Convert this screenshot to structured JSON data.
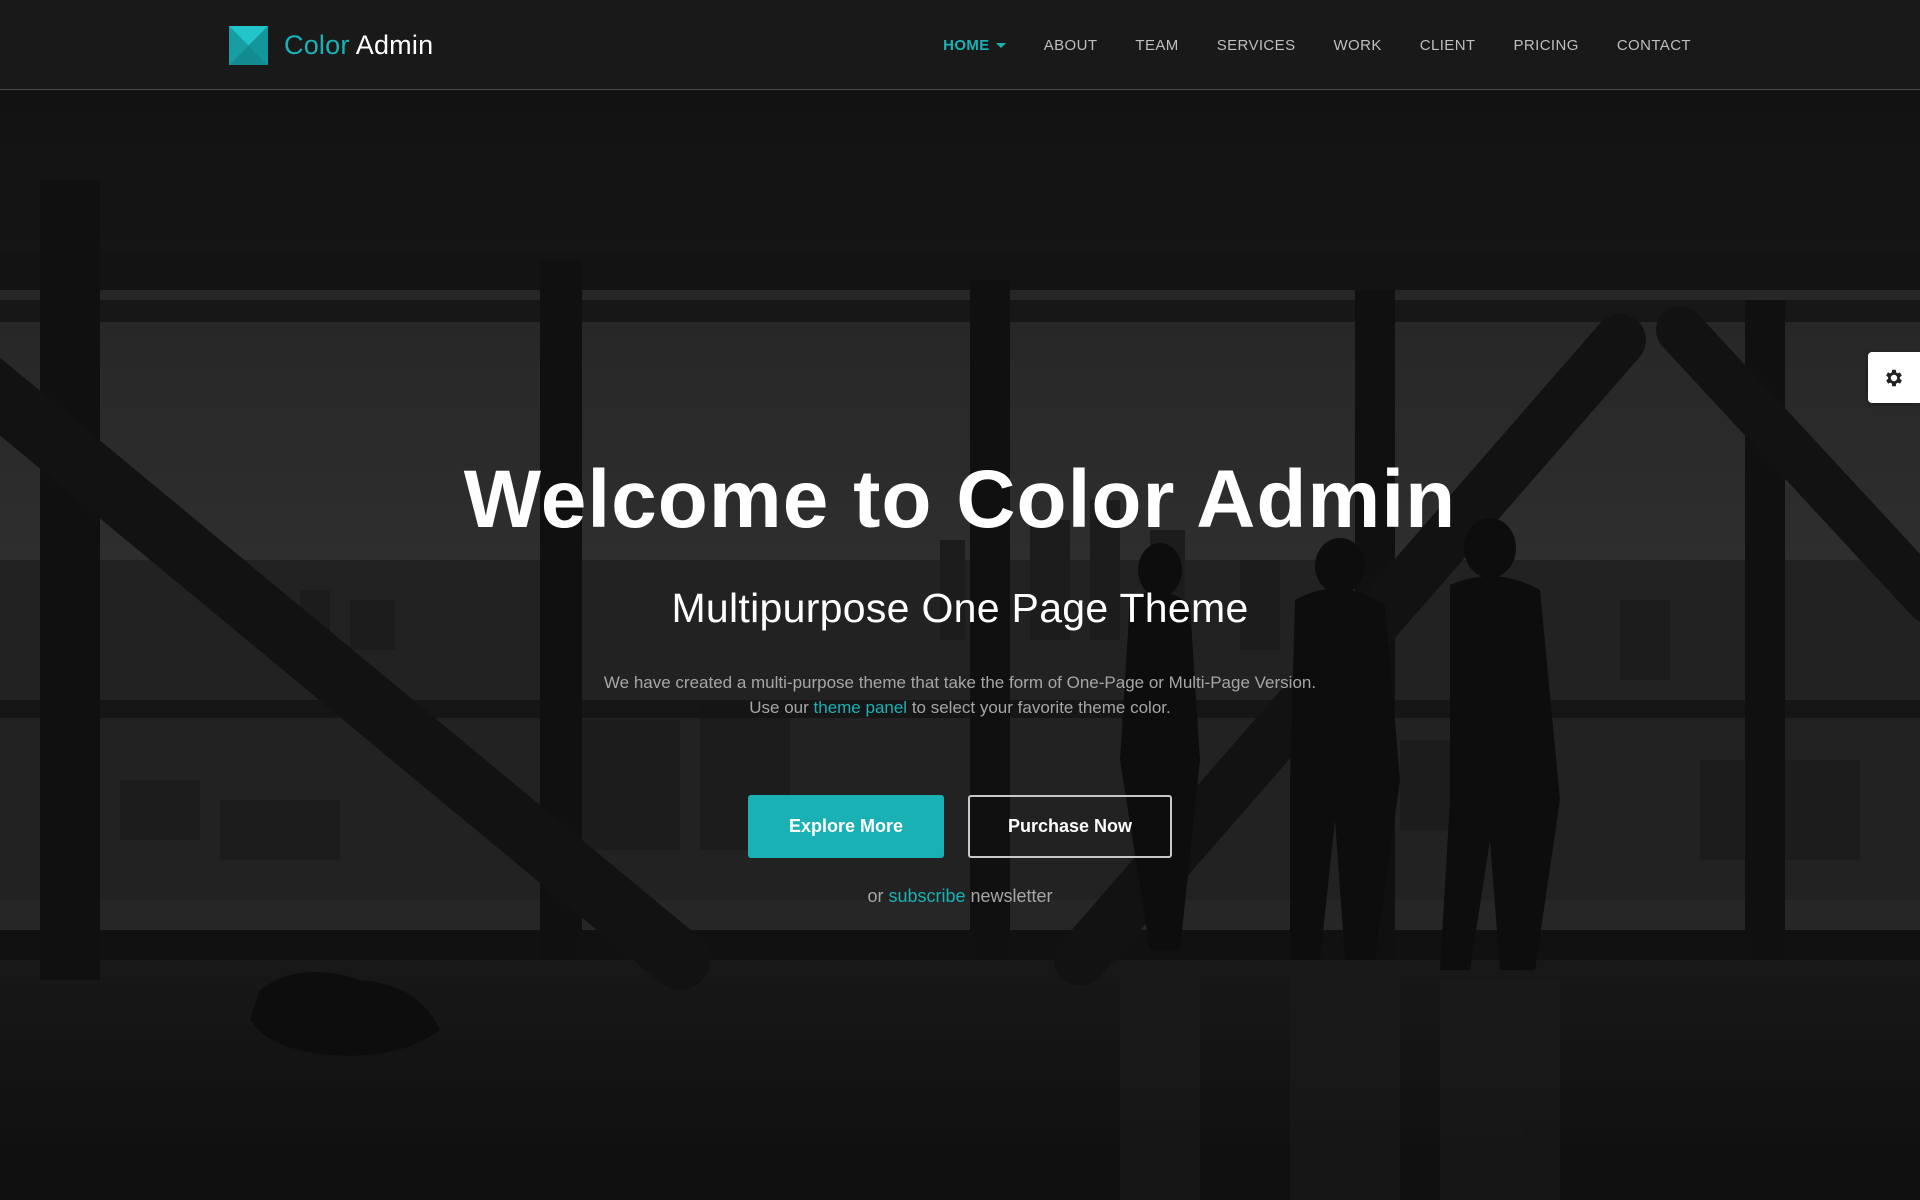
{
  "brand": {
    "name_accent": "Color",
    "name_rest": "Admin"
  },
  "nav": {
    "items": [
      {
        "label": "HOME",
        "active": true
      },
      {
        "label": "ABOUT"
      },
      {
        "label": "TEAM"
      },
      {
        "label": "SERVICES"
      },
      {
        "label": "WORK"
      },
      {
        "label": "CLIENT"
      },
      {
        "label": "PRICING"
      },
      {
        "label": "CONTACT"
      }
    ]
  },
  "hero": {
    "title": "Welcome to Color Admin",
    "subtitle": "Multipurpose One Page Theme",
    "desc_line1": "We have created a multi-purpose theme that take the form of One-Page or Multi-Page Version.",
    "desc_line2_before": "Use our ",
    "desc_line2_link": "theme panel",
    "desc_line2_after": " to select your favorite theme color.",
    "primary_button": "Explore More",
    "secondary_button": "Purchase Now",
    "note_before": "or ",
    "note_link": "subscribe",
    "note_after": " newsletter"
  },
  "colors": {
    "accent": "#1ab1b5",
    "header_bg": "#1a1a1a",
    "text_muted": "#a6a6a6"
  },
  "icons": {
    "logo": "color-admin-logo-icon",
    "theme_toggle": "gear-icon",
    "dropdown": "caret-down-icon"
  }
}
